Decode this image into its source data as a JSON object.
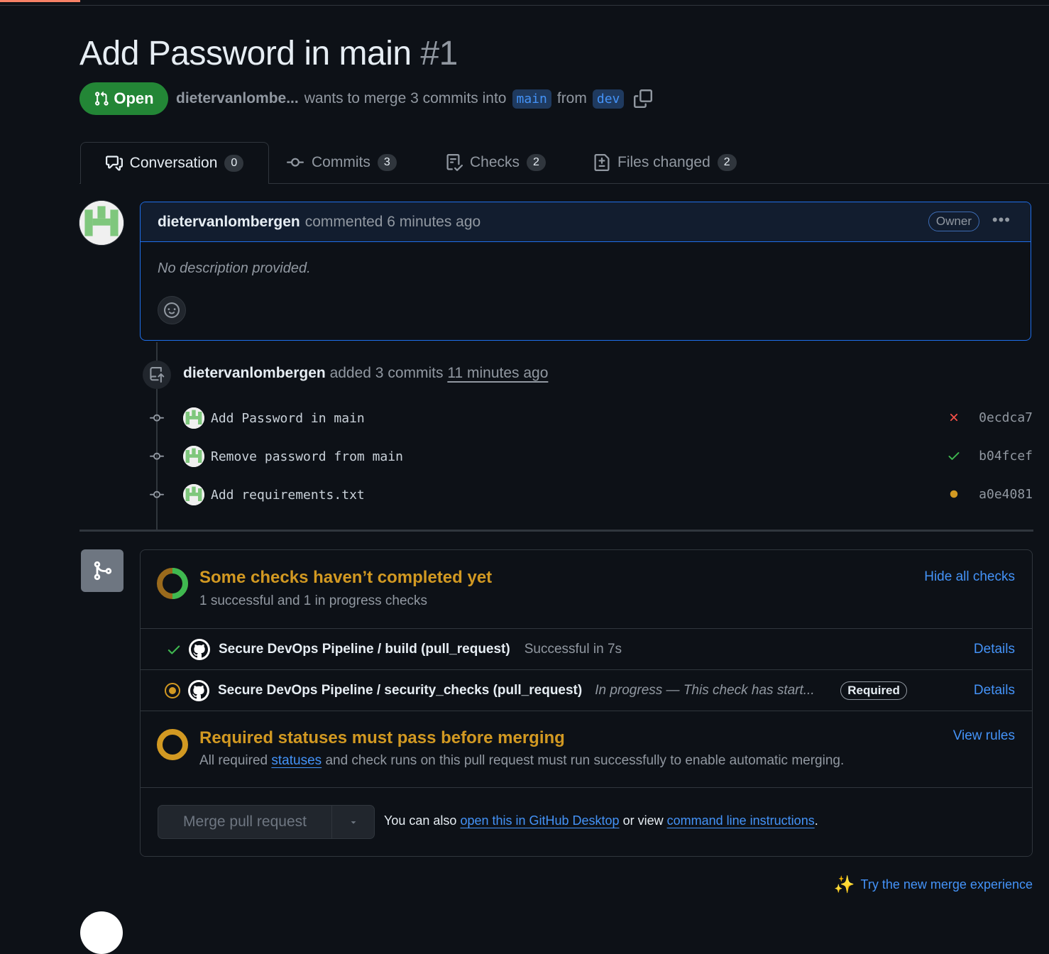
{
  "pr": {
    "title": "Add Password in main",
    "number": "#1",
    "state": "Open",
    "author_short": "dietervanlombe...",
    "meta_text": "wants to merge 3 commits into",
    "base_branch": "main",
    "from_word": "from",
    "head_branch": "dev"
  },
  "tabs": [
    {
      "label": "Conversation",
      "count": "0"
    },
    {
      "label": "Commits",
      "count": "3"
    },
    {
      "label": "Checks",
      "count": "2"
    },
    {
      "label": "Files changed",
      "count": "2"
    }
  ],
  "comment": {
    "author": "dietervanlombergen",
    "action": "commented 6 minutes ago",
    "role": "Owner",
    "body": "No description provided."
  },
  "push_event": {
    "author": "dietervanlombergen",
    "action": "added 3 commits",
    "time": "11 minutes ago"
  },
  "commits": [
    {
      "message": "Add Password in main",
      "sha": "0ecdca7",
      "status": "failure"
    },
    {
      "message": "Remove password from main",
      "sha": "b04fcef",
      "status": "success"
    },
    {
      "message": "Add requirements.txt",
      "sha": "a0e4081",
      "status": "pending"
    }
  ],
  "checks_summary": {
    "title": "Some checks haven’t completed yet",
    "subtitle": "1 successful and 1 in progress checks",
    "toggle_label": "Hide all checks"
  },
  "checks": [
    {
      "name": "Secure DevOps Pipeline / build (pull_request)",
      "status_text": "Successful in 7s",
      "required": "",
      "details": "Details"
    },
    {
      "name": "Secure DevOps Pipeline / security_checks (pull_request)",
      "status_text": "In progress — This check has start...",
      "required": "Required",
      "details": "Details"
    }
  ],
  "required_statuses": {
    "title": "Required statuses must pass before merging",
    "sub_before": "All required",
    "sub_link": "statuses",
    "sub_after": "and check runs on this pull request must run successfully to enable automatic merging.",
    "rules_link": "View rules"
  },
  "merge": {
    "button_label": "Merge pull request",
    "alt_before": "You can also",
    "desktop_link": "open this in GitHub Desktop",
    "alt_middle": "or view",
    "cli_link": "command line instructions",
    "alt_end": "."
  },
  "try_new": {
    "icon": "✨",
    "label": "Try the new merge experience"
  },
  "colors": {
    "background": "#0d1117",
    "accent_blue": "#4493f8",
    "open_green": "#238636",
    "pending_yellow": "#d29922",
    "failure_red": "#f85149"
  }
}
